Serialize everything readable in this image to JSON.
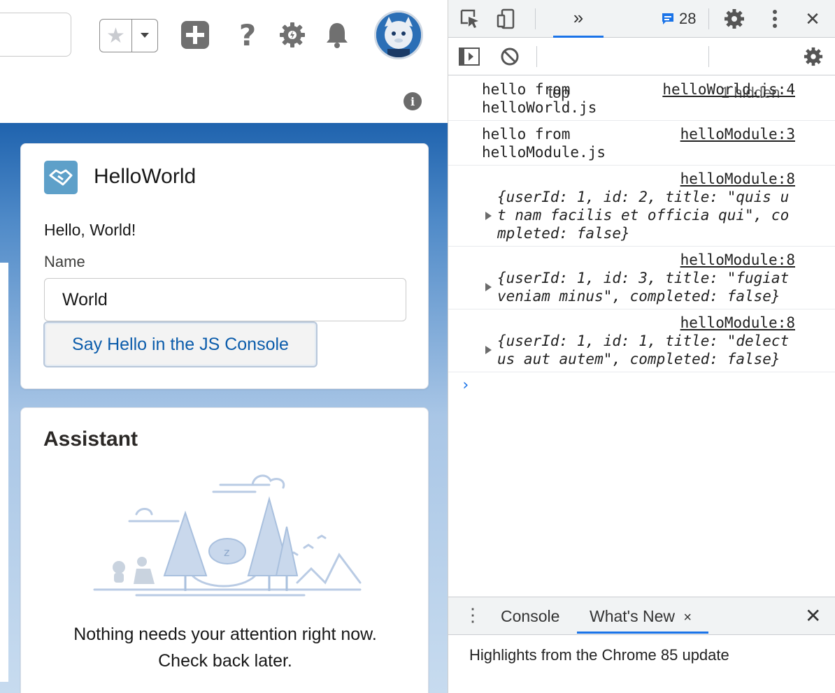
{
  "sf": {
    "header": {
      "icons": [
        "star-icon",
        "chevron-down-icon",
        "plus-icon",
        "help-icon",
        "setup-gear-icon",
        "bell-icon",
        "avatar",
        "info-icon"
      ],
      "info_symbol": "i"
    },
    "hello_card": {
      "title": "HelloWorld",
      "greeting": "Hello, World!",
      "name_label": "Name",
      "name_value": "World",
      "button_label": "Say Hello in the JS Console"
    },
    "assistant_card": {
      "title": "Assistant",
      "message_line1": "Nothing needs your attention right now.",
      "message_line2": "Check back later."
    }
  },
  "devtools": {
    "toolbar": {
      "more_tabs": "»",
      "message_count": "28",
      "close": "✕"
    },
    "toolbar2": {
      "context": "top",
      "hidden": "1 hidden"
    },
    "logs": [
      {
        "text_line1": "hello from",
        "text_line2": "helloWorld.js",
        "source": "helloWorld.js:4"
      },
      {
        "text_line1": "hello from",
        "text_line2": "helloModule.js",
        "source": "helloModule:3"
      }
    ],
    "objects": [
      {
        "source": "helloModule:8",
        "lines": [
          "{userId: 1, id: 2, title: \"quis u",
          "t nam facilis et officia qui\", co",
          "mpleted: false}"
        ]
      },
      {
        "source": "helloModule:8",
        "lines": [
          "{userId: 1, id: 3, title: \"fugiat",
          "veniam minus\", completed: false}"
        ]
      },
      {
        "source": "helloModule:8",
        "lines": [
          "{userId: 1, id: 1, title: \"delect",
          "us aut autem\", completed: false}"
        ]
      }
    ],
    "prompt": "›",
    "drawer": {
      "menu": "⋮",
      "tab_console": "Console",
      "tab_whats_new": "What's New",
      "tab_close": "×",
      "close": "✕",
      "body": "Highlights from the Chrome 85 update"
    }
  }
}
